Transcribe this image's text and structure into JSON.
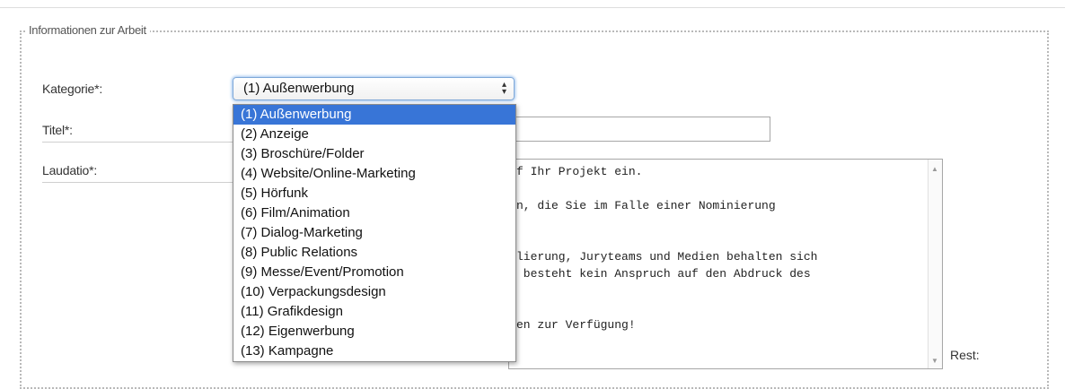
{
  "fieldset": {
    "legend": "Informationen zur Arbeit"
  },
  "labels": {
    "kategorie": "Kategorie*:",
    "titel": "Titel*:",
    "laudatio": "Laudatio*:",
    "rest": "Rest:"
  },
  "kategorie_select": {
    "selected": "(1) Außenwerbung",
    "options": [
      "(1) Außenwerbung",
      "(2) Anzeige",
      "(3) Broschüre/Folder",
      "(4) Website/Online-Marketing",
      "(5) Hörfunk",
      "(6) Film/Animation",
      "(7) Dialog-Marketing",
      "(8) Public Relations",
      "(9) Messe/Event/Promotion",
      "(10) Verpackungsdesign",
      "(11) Grafikdesign",
      "(12) Eigenwerbung",
      "(13) Kampagne"
    ]
  },
  "laudatio_visible_lines": [
    "f Ihr Projekt ein.",
    "",
    "n, die Sie im Falle einer Nominierung",
    "",
    "",
    "lierung, Juryteams und Medien behalten sich",
    " besteht kein Anspruch auf den Abdruck des",
    "",
    "",
    "en zur Verfügung!"
  ],
  "icons": {
    "select_arrows": "up-down-arrows-icon",
    "scroll_up": "scroll-up-arrow-icon",
    "scroll_down": "scroll-down-arrow-icon"
  },
  "colors": {
    "selected_option_bg": "#3875d7",
    "focus_ring": "#9cc3ef"
  }
}
